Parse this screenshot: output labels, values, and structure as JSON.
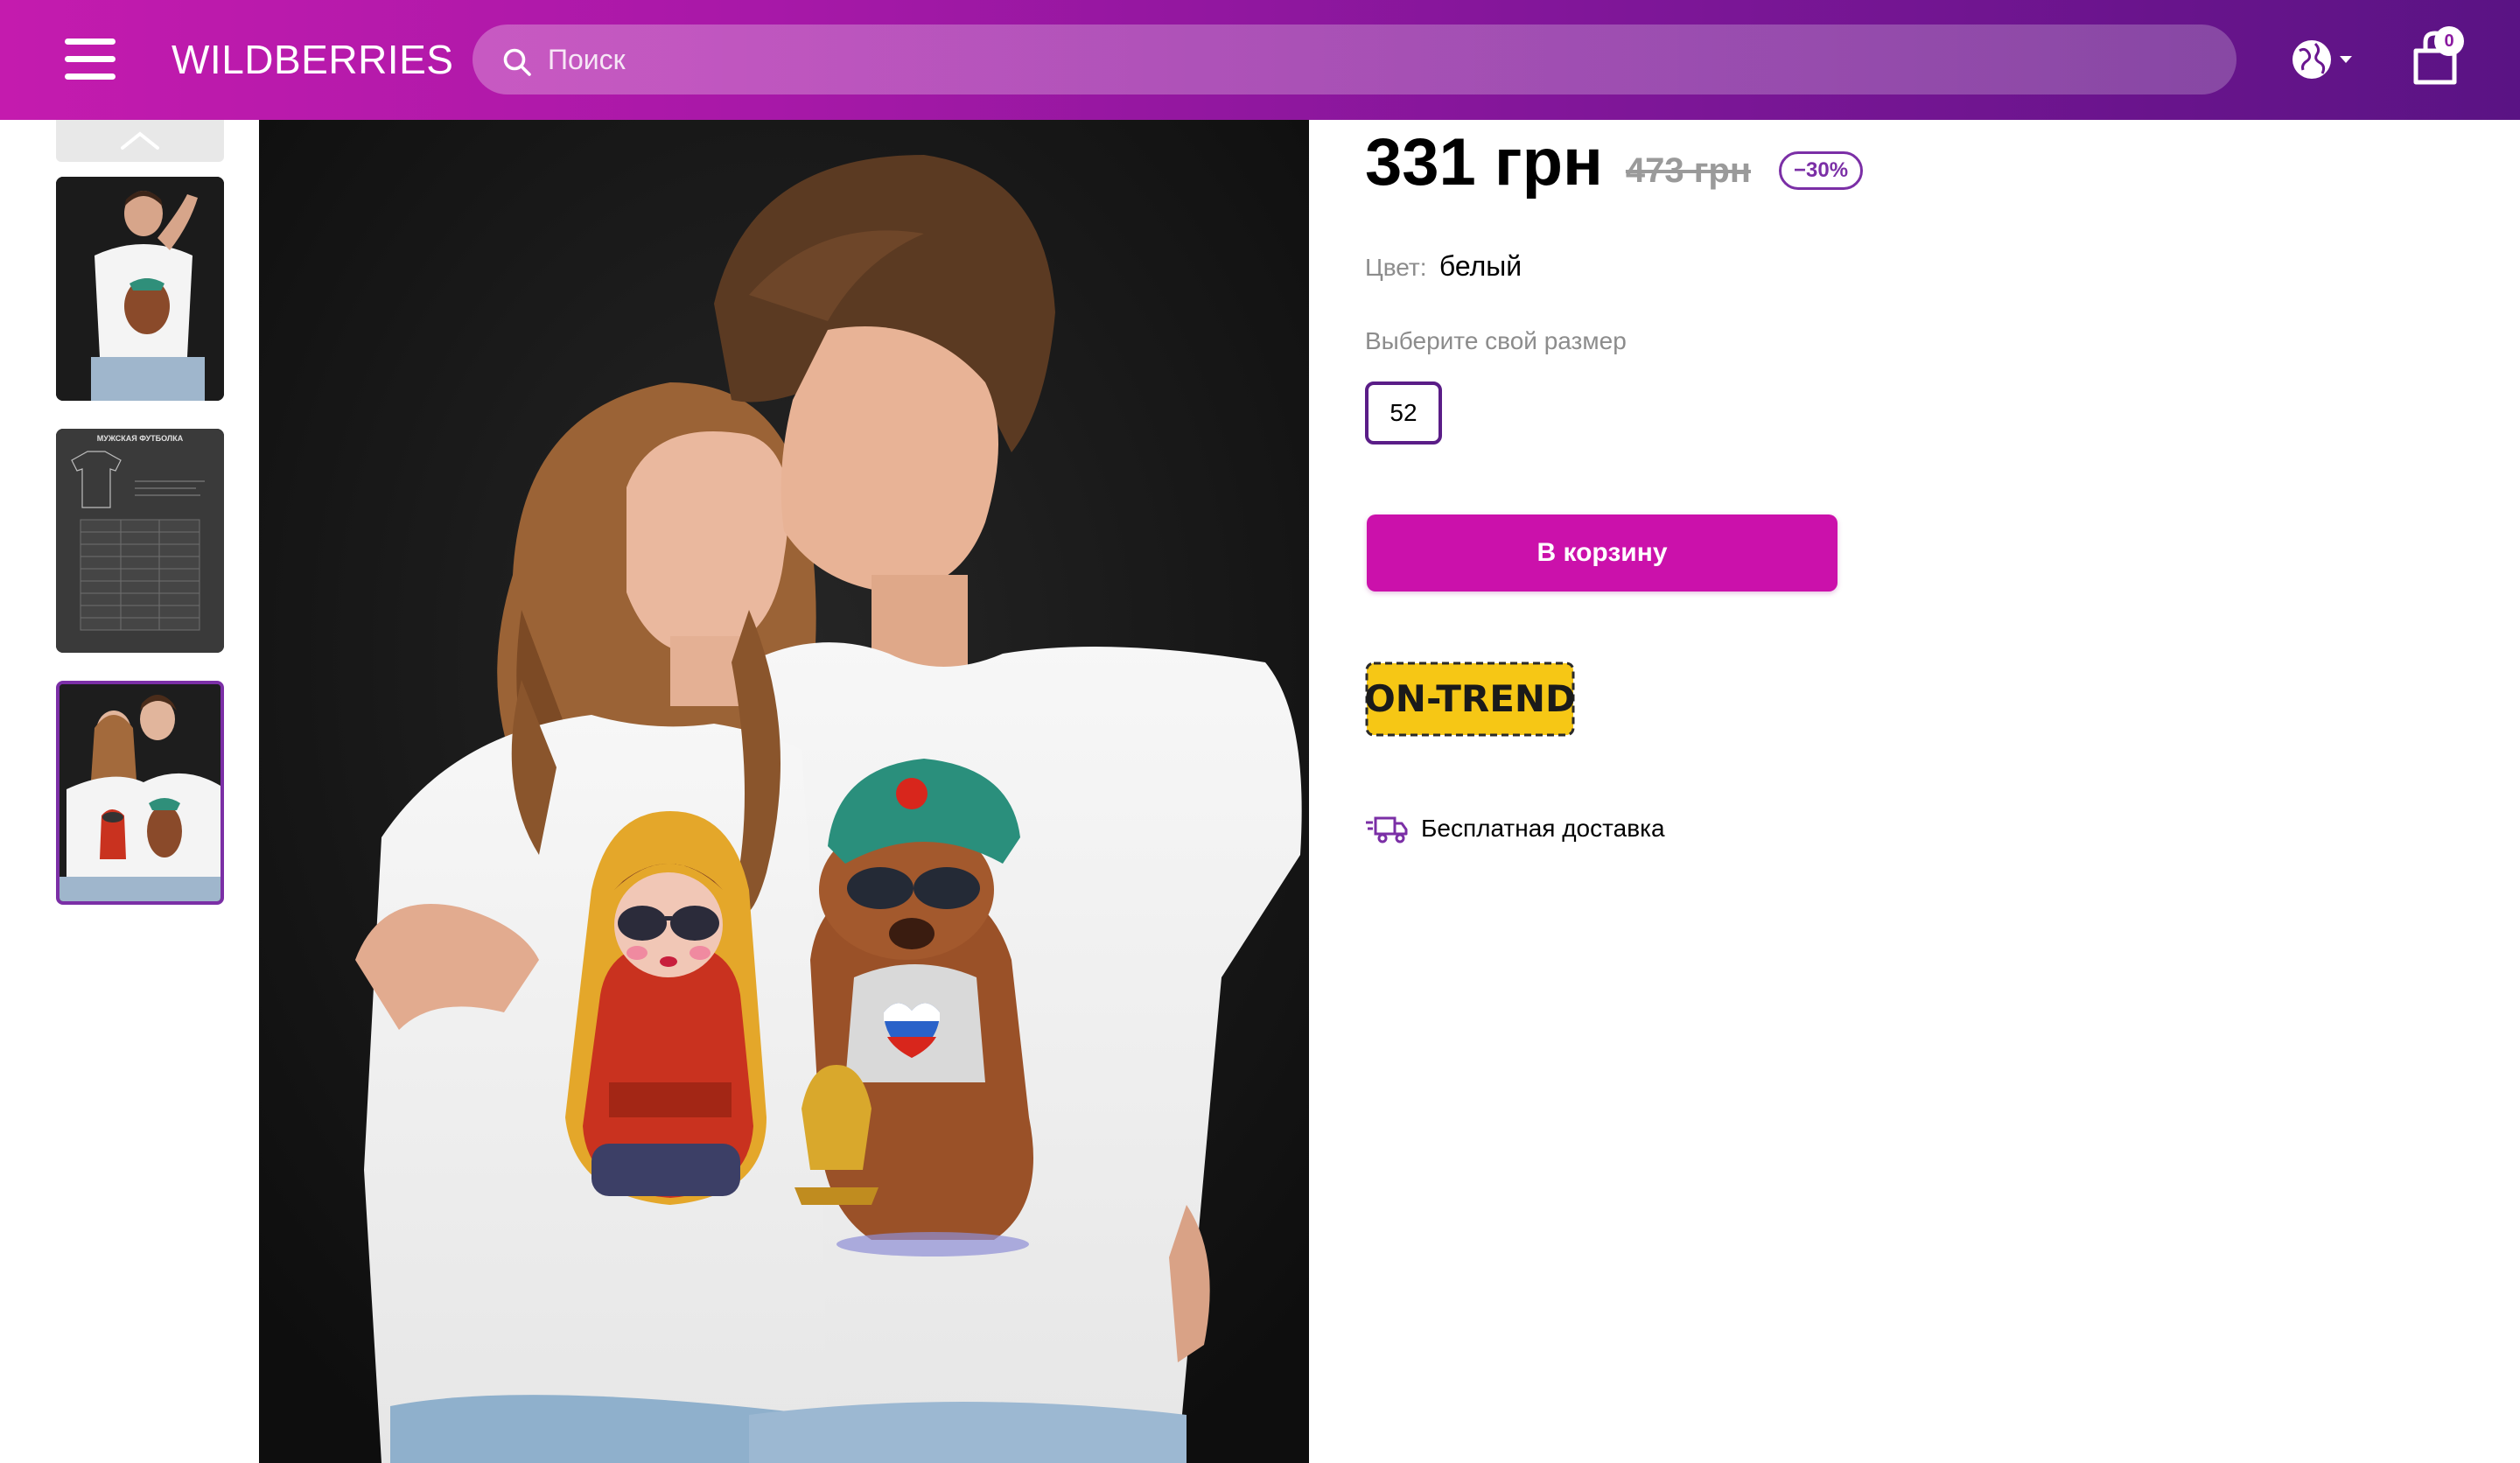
{
  "header": {
    "logo": "WILDBERRIES",
    "search_placeholder": "Поиск",
    "cart_count": "0",
    "menu_icon": "burger-menu-icon",
    "search_icon": "search-icon",
    "globe_icon": "globe-icon",
    "cart_icon": "shopping-bag-icon",
    "colors": {
      "gradient_start": "#c41bae",
      "gradient_end": "#5a1384"
    }
  },
  "gallery": {
    "thumbnails": [
      {
        "type": "photo"
      },
      {
        "type": "size-chart",
        "title": "МУЖСКАЯ ФУТБОЛКА"
      },
      {
        "type": "photo",
        "selected": true
      }
    ]
  },
  "product": {
    "price": "331 грн",
    "old_price": "473 грн",
    "discount": "−30%",
    "color_label": "Цвет:",
    "color_value": "белый",
    "size_label": "Выберите свой размер",
    "sizes": [
      "52"
    ],
    "add_to_cart": "В корзину",
    "trend_badge": "ON-TREND",
    "delivery": "Бесплатная доставка",
    "accent_color": "#cb11ab",
    "outline_color": "#7b2fa6"
  }
}
